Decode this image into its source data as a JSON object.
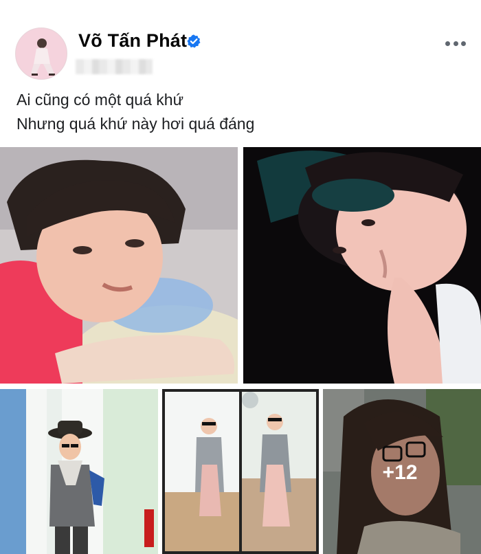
{
  "post": {
    "author": "Võ Tấn Phát",
    "verified": true,
    "caption_lines": [
      "Ai cũng có một quá khứ",
      "Nhưng quá khứ này hơi quá đáng"
    ],
    "more_photos_label": "+12",
    "accent_color": "#1877f2",
    "icons": {
      "verified": "verified-badge-icon",
      "more": "more-options-icon"
    }
  }
}
